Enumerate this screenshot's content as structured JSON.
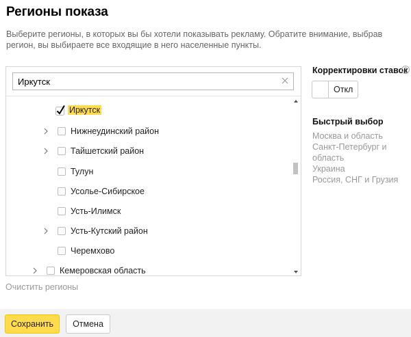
{
  "page": {
    "title": "Регионы показа",
    "description": "Выберите регионы, в которых вы бы хотели показывать рекламу. Обратите внимание, выбрав регион, вы выбираете все входящие в него населенные пункты."
  },
  "search": {
    "value": "Иркутск",
    "clear_icon": "close-icon"
  },
  "tree": {
    "items": [
      {
        "label": "Иркутск",
        "checked": true,
        "expandable": false,
        "highlighted": true
      },
      {
        "label": "Нижнеудинский район",
        "checked": false,
        "expandable": true
      },
      {
        "label": "Тайшетский район",
        "checked": false,
        "expandable": true
      },
      {
        "label": "Тулун",
        "checked": false,
        "expandable": false
      },
      {
        "label": "Усолье-Сибирское",
        "checked": false,
        "expandable": false
      },
      {
        "label": "Усть-Илимск",
        "checked": false,
        "expandable": false
      },
      {
        "label": "Усть-Кутский район",
        "checked": false,
        "expandable": true
      },
      {
        "label": "Черемхово",
        "checked": false,
        "expandable": false
      },
      {
        "label": "Кемеровская область",
        "checked": false,
        "expandable": true
      }
    ],
    "clear_link": "Очистить регионы"
  },
  "bid_adjustments": {
    "heading": "Корректировки ставок",
    "help_icon": "help-icon",
    "toggle_label": "Откл",
    "toggle_on": false
  },
  "quick_select": {
    "heading": "Быстрый выбор",
    "items": [
      "Москва и область",
      "Санкт-Петербург и область",
      "Украина",
      "Россия, СНГ и Грузия"
    ]
  },
  "footer": {
    "save_label": "Сохранить",
    "cancel_label": "Отмена"
  },
  "colors": {
    "accent": "#ffdb4d",
    "muted_text": "#999999",
    "footer_bg": "#f2f2f2"
  }
}
